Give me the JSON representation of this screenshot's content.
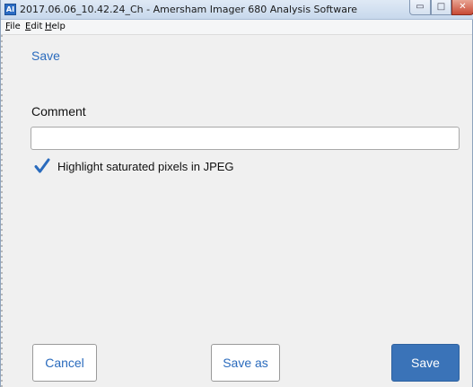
{
  "window": {
    "title": "2017.06.06_10.42.24_Ch - Amersham Imager 680 Analysis Software",
    "app_icon_text": "AI",
    "min_glyph": "▭",
    "max_glyph": "□",
    "close_glyph": "✕"
  },
  "menu": {
    "items": [
      "File",
      "Edit",
      "Help"
    ]
  },
  "dialog": {
    "title": "Save",
    "comment_label": "Comment",
    "comment_value": "",
    "comment_placeholder": "",
    "highlight_label": "Highlight saturated pixels in JPEG",
    "highlight_checked": true
  },
  "buttons": {
    "cancel": "Cancel",
    "save_as": "Save as",
    "save": "Save"
  },
  "colors": {
    "accent": "#2a6bbd",
    "primary_button": "#3a73b8"
  },
  "icons": {
    "app": "amersham-app-icon",
    "check": "checkmark-icon"
  }
}
